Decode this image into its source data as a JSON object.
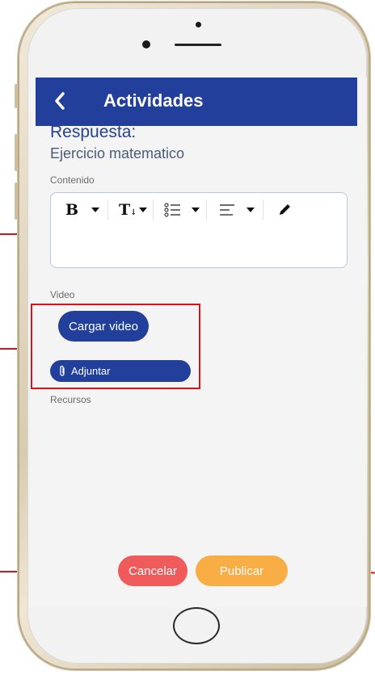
{
  "app_bar": {
    "back_icon": "chevron-left-icon",
    "title": "Actividades",
    "color": "#22409b"
  },
  "response": {
    "title": "Respuesta:",
    "subtitle": "Ejercicio matematico"
  },
  "content_section": {
    "label": "Contenido",
    "toolbar": [
      {
        "icon": "bold-icon",
        "glyph": "B",
        "has_dropdown": true
      },
      {
        "icon": "text-size-icon",
        "glyph": "T",
        "has_dropdown": true
      },
      {
        "icon": "bullet-list-icon",
        "has_dropdown": true
      },
      {
        "icon": "align-left-icon",
        "has_dropdown": true
      },
      {
        "icon": "pencil-icon",
        "has_dropdown": false
      }
    ]
  },
  "video_section": {
    "label": "Video",
    "upload_button": "Cargar video",
    "attach_button": "Adjuntar",
    "attach_icon": "paperclip-icon"
  },
  "resources_section": {
    "label": "Recursos"
  },
  "actions": {
    "cancel": "Cancelar",
    "publish": "Publicar",
    "cancel_color": "#ef5b5b",
    "publish_color": "#f9ad45"
  },
  "annotation_color": "#d6141a"
}
